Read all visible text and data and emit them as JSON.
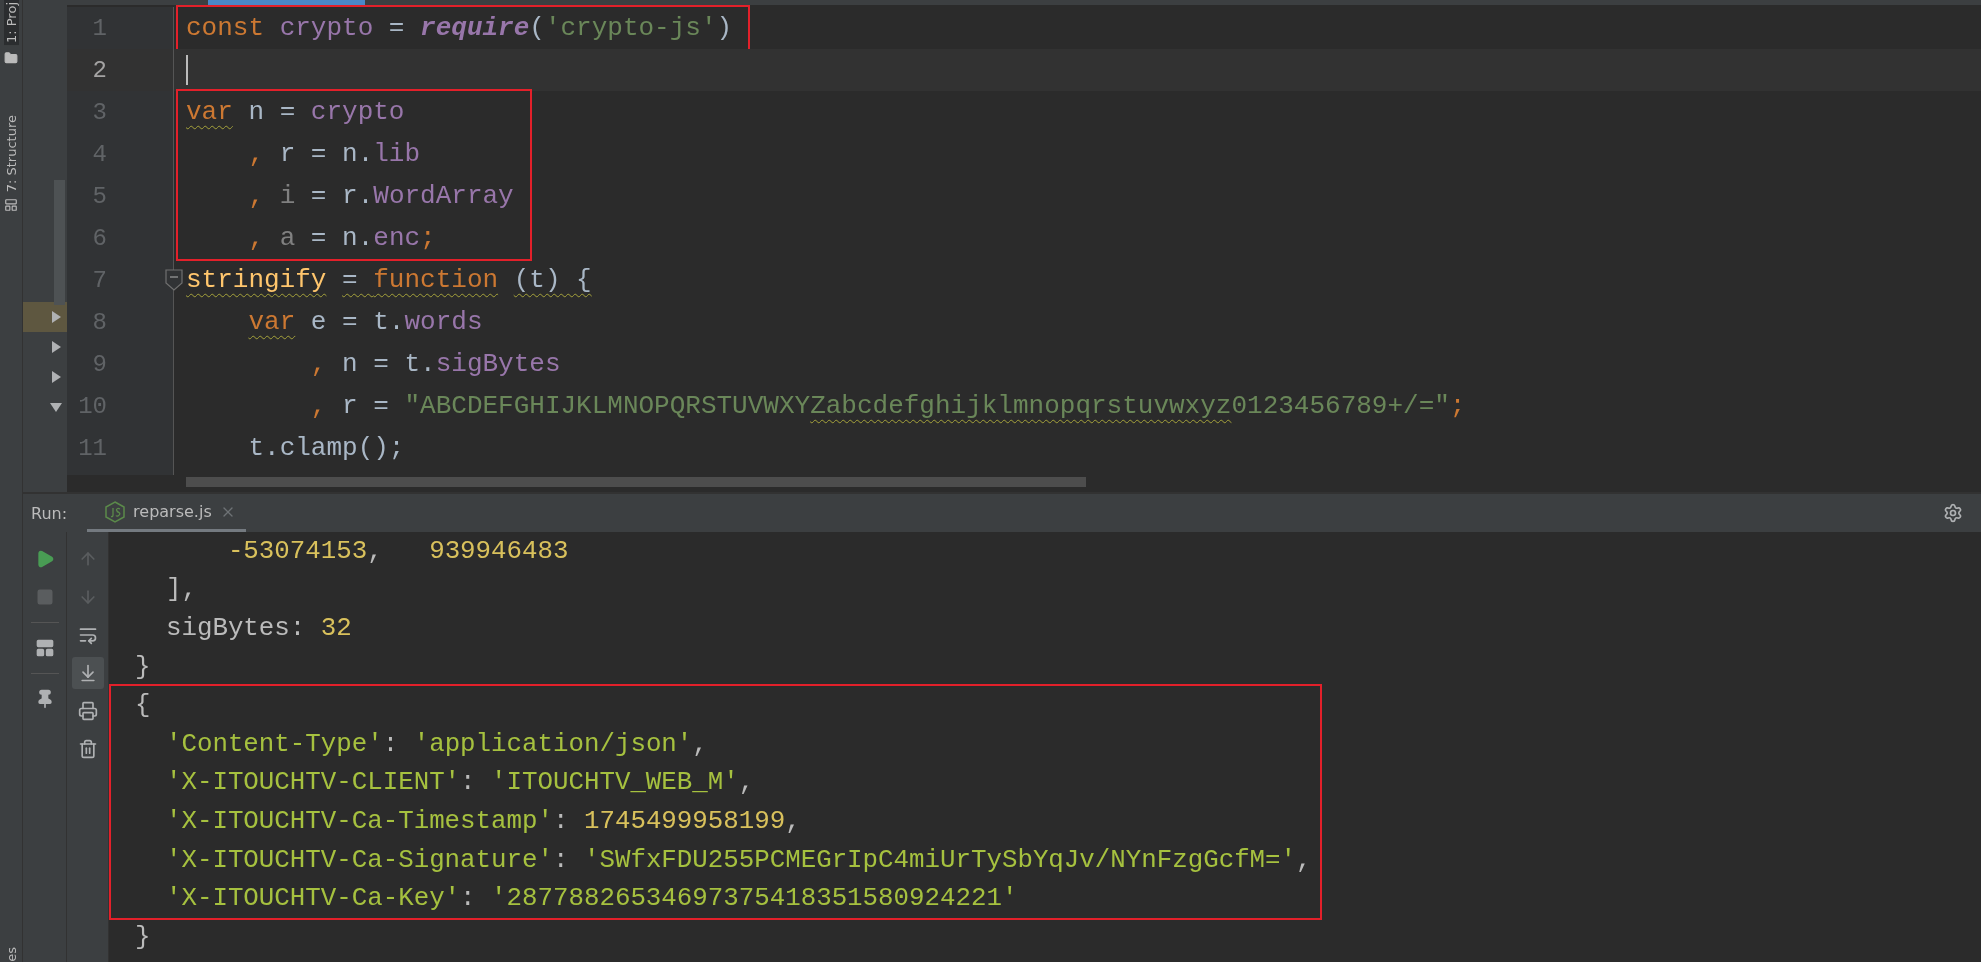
{
  "tool_strip": {
    "labels": [
      {
        "text": "1: Proj",
        "kind": "project",
        "selected": true
      },
      {
        "text": "7: Structure",
        "kind": "structure",
        "selected": false
      },
      {
        "text": "es",
        "kind": "bottom",
        "selected": false
      }
    ]
  },
  "project_panel": {
    "rows": [
      {
        "expanded": false,
        "selected": true
      },
      {
        "expanded": false,
        "selected": false
      },
      {
        "expanded": false,
        "selected": false
      },
      {
        "expanded": true,
        "selected": false
      }
    ]
  },
  "editor": {
    "blocks": [
      {
        "highlighted": true,
        "lines": [
          {
            "number": "1",
            "current": false,
            "foldable": false,
            "tokens": [
              {
                "text": "const ",
                "kind": "keyword",
                "wavy": false
              },
              {
                "text": "crypto",
                "kind": "ident",
                "wavy": false
              },
              {
                "text": " = ",
                "kind": "plain",
                "wavy": false
              },
              {
                "text": "require",
                "kind": "builtin",
                "wavy": false
              },
              {
                "text": "(",
                "kind": "plain",
                "wavy": false
              },
              {
                "text": "'crypto-js'",
                "kind": "string",
                "wavy": false
              },
              {
                "text": ")",
                "kind": "plain",
                "wavy": false
              }
            ]
          }
        ]
      },
      {
        "highlighted": false,
        "lines": [
          {
            "number": "2",
            "current": true,
            "foldable": false
          }
        ]
      },
      {
        "highlighted": true,
        "lines": [
          {
            "number": "3",
            "current": false,
            "foldable": false,
            "tokens": [
              {
                "text": "var",
                "kind": "keyword",
                "wavy": true
              },
              {
                "text": " n = ",
                "kind": "plain",
                "wavy": false
              },
              {
                "text": "crypto",
                "kind": "ident",
                "wavy": false
              }
            ]
          },
          {
            "number": "4",
            "current": false,
            "foldable": false,
            "tokens": [
              {
                "text": "    ,",
                "kind": "keyword",
                "wavy": false
              },
              {
                "text": " r = n.",
                "kind": "plain",
                "wavy": false
              },
              {
                "text": "lib",
                "kind": "ident",
                "wavy": false
              }
            ]
          },
          {
            "number": "5",
            "current": false,
            "foldable": false,
            "tokens": [
              {
                "text": "    ,",
                "kind": "keyword",
                "wavy": false
              },
              {
                "text": " i",
                "kind": "unused",
                "wavy": false
              },
              {
                "text": " = r.",
                "kind": "plain",
                "wavy": false
              },
              {
                "text": "WordArray",
                "kind": "ident",
                "wavy": false
              }
            ]
          },
          {
            "number": "6",
            "current": false,
            "foldable": false,
            "tokens": [
              {
                "text": "    ,",
                "kind": "keyword",
                "wavy": false
              },
              {
                "text": " a",
                "kind": "unused",
                "wavy": false
              },
              {
                "text": " = n.",
                "kind": "plain",
                "wavy": false
              },
              {
                "text": "enc",
                "kind": "ident",
                "wavy": false
              },
              {
                "text": ";",
                "kind": "keyword",
                "wavy": false
              }
            ]
          }
        ]
      },
      {
        "highlighted": false,
        "lines": [
          {
            "number": "7",
            "current": false,
            "foldable": true,
            "tokens": [
              {
                "text": "stringify",
                "kind": "func",
                "wavy": true
              },
              {
                "text": " = ",
                "kind": "plain",
                "wavy": true
              },
              {
                "text": "function",
                "kind": "keyword",
                "wavy": true
              },
              {
                "text": " (t) {",
                "kind": "plain",
                "wavy": true
              }
            ]
          },
          {
            "number": "8",
            "current": false,
            "foldable": false,
            "tokens": [
              {
                "text": "    var",
                "kind": "keyword",
                "wavy": true
              },
              {
                "text": " e = t.",
                "kind": "plain",
                "wavy": false
              },
              {
                "text": "words",
                "kind": "ident",
                "wavy": false
              }
            ]
          },
          {
            "number": "9",
            "current": false,
            "foldable": false,
            "tokens": [
              {
                "text": "        ,",
                "kind": "keyword",
                "wavy": false
              },
              {
                "text": " n = t.",
                "kind": "plain",
                "wavy": false
              },
              {
                "text": "sigBytes",
                "kind": "ident",
                "wavy": false
              }
            ]
          },
          {
            "number": "10",
            "current": false,
            "foldable": false,
            "tokens": [
              {
                "text": "        ,",
                "kind": "keyword",
                "wavy": false
              },
              {
                "text": " r = ",
                "kind": "plain",
                "wavy": false
              },
              {
                "text": "\"ABCDEFGHIJKLMNOPQRSTUVWXY",
                "kind": "string",
                "wavy": false
              },
              {
                "text": "Zabcdefghijklmnopqrstuvwxyz",
                "kind": "string",
                "wavy": true
              },
              {
                "text": "0123456789+/=\"",
                "kind": "string",
                "wavy": false
              },
              {
                "text": ";",
                "kind": "keyword",
                "wavy": false
              }
            ]
          },
          {
            "number": "11",
            "current": false,
            "foldable": false,
            "tokens": [
              {
                "text": "    t.clamp();",
                "kind": "plain",
                "wavy": false
              }
            ]
          }
        ]
      }
    ]
  },
  "run_panel": {
    "label": "Run:",
    "tabs": [
      {
        "label": "reparse.js",
        "selected": true
      }
    ]
  },
  "run_tools": [
    {
      "kind": "run",
      "disabled": false
    },
    {
      "kind": "stop",
      "disabled": true
    },
    {
      "kind": "layout",
      "disabled": false
    },
    {
      "kind": "pin",
      "disabled": false
    }
  ],
  "console_tools": [
    {
      "kind": "up",
      "disabled": true,
      "on": false
    },
    {
      "kind": "down",
      "disabled": true,
      "on": false
    },
    {
      "kind": "wrap",
      "disabled": false,
      "on": false
    },
    {
      "kind": "scroll_end",
      "disabled": false,
      "on": true
    },
    {
      "kind": "print",
      "disabled": false,
      "on": false
    },
    {
      "kind": "trash",
      "disabled": false,
      "on": false
    }
  ],
  "console": {
    "blocks": [
      {
        "highlighted": false,
        "lines": [
          {
            "tokens": [
              {
                "text": "      -53074153",
                "kind": "number"
              },
              {
                "text": ",   ",
                "kind": "plain"
              },
              {
                "text": "939946483",
                "kind": "number"
              }
            ]
          },
          {
            "tokens": [
              {
                "text": "  ],",
                "kind": "plain"
              }
            ]
          },
          {
            "tokens": [
              {
                "text": "  sigBytes: ",
                "kind": "plain"
              },
              {
                "text": "32",
                "kind": "number"
              }
            ]
          },
          {
            "tokens": [
              {
                "text": "}",
                "kind": "plain"
              }
            ]
          }
        ]
      },
      {
        "highlighted": true,
        "lines": [
          {
            "tokens": [
              {
                "text": "{",
                "kind": "plain"
              }
            ]
          },
          {
            "tokens": [
              {
                "text": "  'Content-Type'",
                "kind": "string"
              },
              {
                "text": ": ",
                "kind": "plain"
              },
              {
                "text": "'application/json'",
                "kind": "string"
              },
              {
                "text": ",",
                "kind": "plain"
              }
            ]
          },
          {
            "tokens": [
              {
                "text": "  'X-ITOUCHTV-CLIENT'",
                "kind": "string"
              },
              {
                "text": ": ",
                "kind": "plain"
              },
              {
                "text": "'ITOUCHTV_WEB_M'",
                "kind": "string"
              },
              {
                "text": ",",
                "kind": "plain"
              }
            ]
          },
          {
            "tokens": [
              {
                "text": "  'X-ITOUCHTV-Ca-Timestamp'",
                "kind": "string"
              },
              {
                "text": ": ",
                "kind": "plain"
              },
              {
                "text": "1745499958199",
                "kind": "number"
              },
              {
                "text": ",",
                "kind": "plain"
              }
            ]
          },
          {
            "tokens": [
              {
                "text": "  'X-ITOUCHTV-Ca-Signature'",
                "kind": "string"
              },
              {
                "text": ": ",
                "kind": "plain"
              },
              {
                "text": "'SWfxFDU255PCMEGrIpC4miUrTySbYqJv/NYnFzgGcfM='",
                "kind": "string"
              },
              {
                "text": ",",
                "kind": "plain"
              }
            ]
          },
          {
            "tokens": [
              {
                "text": "  'X-ITOUCHTV-Ca-Key'",
                "kind": "string"
              },
              {
                "text": ": ",
                "kind": "plain"
              },
              {
                "text": "'28778826534697375418351580924221'",
                "kind": "string"
              }
            ]
          }
        ]
      },
      {
        "highlighted": false,
        "lines": [
          {
            "tokens": [
              {
                "text": "}",
                "kind": "plain"
              }
            ]
          }
        ]
      }
    ]
  }
}
